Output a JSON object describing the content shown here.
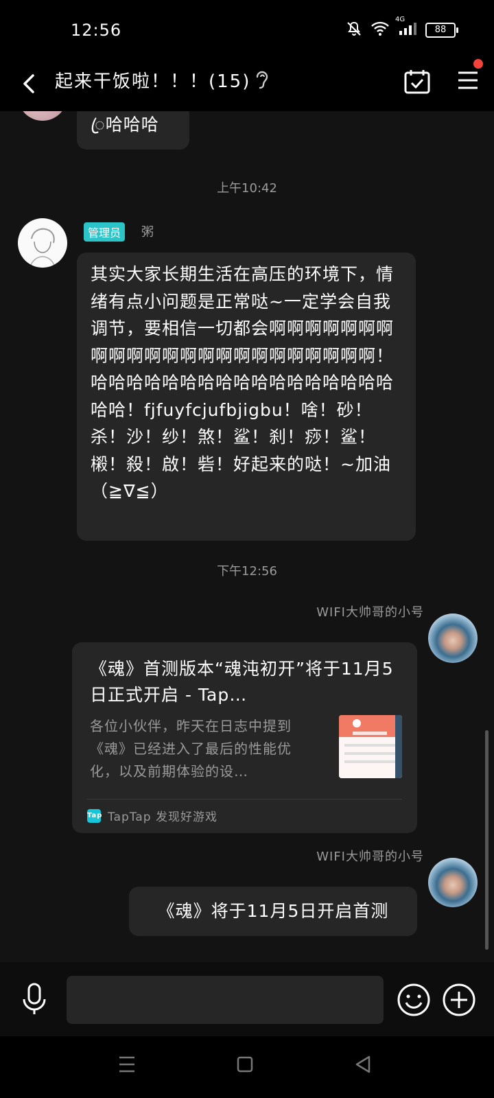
{
  "status_bar": {
    "time": "12:56",
    "network": "4G",
    "battery": "88"
  },
  "header": {
    "title": "起来干饭啦！！！(15)"
  },
  "messages": {
    "prev_tail": "ꦿ哈哈哈",
    "ts1": "上午10:42",
    "msg1": {
      "badge": "管理员",
      "sender": "粥",
      "text": "其实大家长期生活在高压的环境下，情绪有点小问题是正常哒~一定学会自我调节，要相信一切都会啊啊啊啊啊啊啊啊啊啊啊啊啊啊啊啊啊啊啊啊啊啊啊！哈哈哈哈哈哈哈哈哈哈哈哈哈哈哈哈哈哈哈！fjfuyfcjufbjigbu！啥！砂！杀！沙！纱！煞！鲨！刹！痧！鲨！樧！殺！啟！砦！好起来的哒！~加油（≧∇≦）"
    },
    "ts2": "下午12:56",
    "msg2": {
      "sender": "WIFI大帅哥的小号",
      "card_title": "《魂》首测版本“魂沌初开”将于11月5日正式开启 - Tap…",
      "card_desc": "各位小伙伴，昨天在日志中提到《魂》已经进入了最后的性能优化，以及前期体验的设…",
      "card_source": "TapTap 发现好游戏",
      "tap_logo": "Tap"
    },
    "msg3": {
      "sender": "WIFI大帅哥的小号",
      "text": "《魂》将于11月5日开启首测"
    }
  },
  "input": {
    "value": "",
    "placeholder": ""
  },
  "colors": {
    "badge": "#2bc4c8",
    "notify_dot": "#f4433b",
    "bubble": "#262626",
    "background": "#131313"
  }
}
